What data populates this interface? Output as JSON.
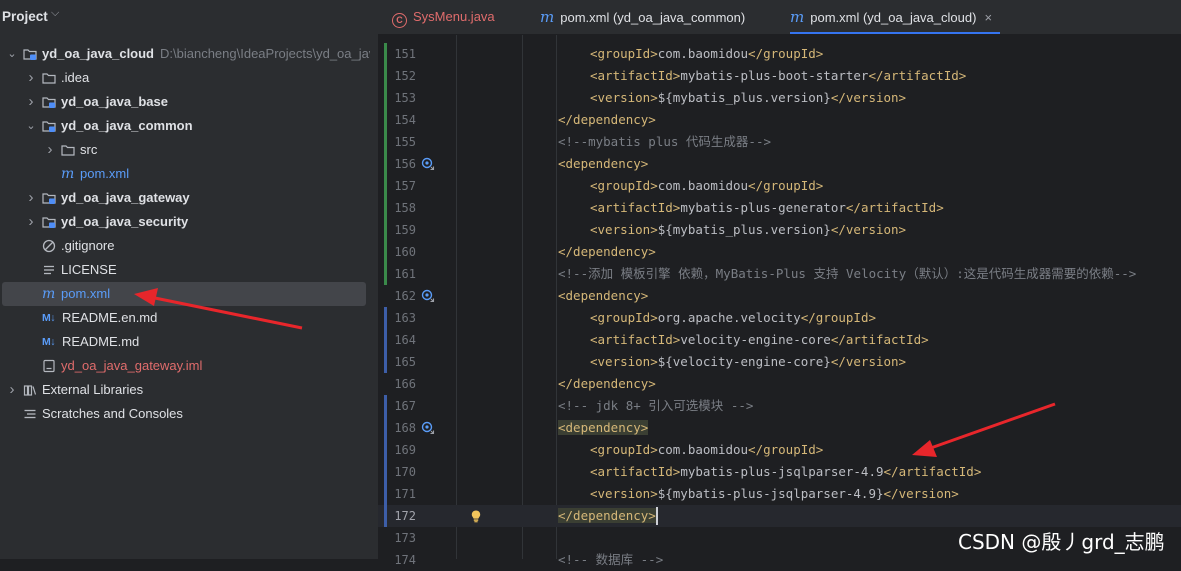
{
  "panel": {
    "title": "Project",
    "tree": [
      {
        "label": "yd_oa_java_cloud",
        "path": "D:\\biancheng\\IdeaProjects\\yd_oa_java_cloud",
        "icon": "module-folder-icon",
        "expanded": true
      },
      {
        "label": ".idea",
        "icon": "folder-icon"
      },
      {
        "label": "yd_oa_java_base",
        "icon": "module-folder-icon"
      },
      {
        "label": "yd_oa_java_common",
        "icon": "module-folder-icon",
        "expanded": true
      },
      {
        "label": "src",
        "icon": "folder-icon"
      },
      {
        "label": "pom.xml",
        "icon": "maven-icon"
      },
      {
        "label": "yd_oa_java_gateway",
        "icon": "module-folder-icon"
      },
      {
        "label": "yd_oa_java_security",
        "icon": "module-folder-icon"
      },
      {
        "label": ".gitignore",
        "icon": "ignore-icon"
      },
      {
        "label": "LICENSE",
        "icon": "text-file-icon"
      },
      {
        "label": "pom.xml",
        "icon": "maven-icon",
        "selected": true
      },
      {
        "label": "README.en.md",
        "icon": "markdown-icon",
        "icon_text": "M↓"
      },
      {
        "label": "README.md",
        "icon": "markdown-icon",
        "icon_text": "M↓"
      },
      {
        "label": "yd_oa_java_gateway.iml",
        "icon": "iml-file-icon"
      },
      {
        "label": "External Libraries",
        "icon": "libraries-icon"
      },
      {
        "label": "Scratches and Consoles",
        "icon": "scratches-icon"
      }
    ]
  },
  "tabs": [
    {
      "label": "SysMenu.java",
      "icon": "java-class-icon",
      "icon_text": "C"
    },
    {
      "label": "pom.xml (yd_oa_java_common)",
      "icon": "maven-icon"
    },
    {
      "label": "pom.xml (yd_oa_java_cloud)",
      "icon": "maven-icon",
      "active": true,
      "close": "×"
    }
  ],
  "maven_glyph": "m",
  "editor": {
    "lines": [
      {
        "n": "151",
        "code": "<groupId>com.baomidou</groupId>"
      },
      {
        "n": "152",
        "code": "<artifactId>mybatis-plus-boot-starter</artifactId>"
      },
      {
        "n": "153",
        "code": "<version>${mybatis_plus.version}</version>"
      },
      {
        "n": "154",
        "code": "</dependency>"
      },
      {
        "n": "155",
        "code": "<!--mybatis plus 代码生成器-->"
      },
      {
        "n": "156",
        "code": "<dependency>"
      },
      {
        "n": "157",
        "code": "<groupId>com.baomidou</groupId>"
      },
      {
        "n": "158",
        "code": "<artifactId>mybatis-plus-generator</artifactId>"
      },
      {
        "n": "159",
        "code": "<version>${mybatis_plus.version}</version>"
      },
      {
        "n": "160",
        "code": "</dependency>"
      },
      {
        "n": "161",
        "code": "<!--添加 模板引擎 依赖，MyBatis-Plus 支持 Velocity（默认）:这是代码生成器需要的依赖-->"
      },
      {
        "n": "162",
        "code": "<dependency>"
      },
      {
        "n": "163",
        "code": "<groupId>org.apache.velocity</groupId>"
      },
      {
        "n": "164",
        "code": "<artifactId>velocity-engine-core</artifactId>"
      },
      {
        "n": "165",
        "code": "<version>${velocity-engine-core}</version>"
      },
      {
        "n": "166",
        "code": "</dependency>"
      },
      {
        "n": "167",
        "code": "<!-- jdk 8+ 引入可选模块 -->"
      },
      {
        "n": "168",
        "code": "<dependency>"
      },
      {
        "n": "169",
        "code": "<groupId>com.baomidou</groupId>"
      },
      {
        "n": "170",
        "code": "<artifactId>mybatis-plus-jsqlparser-4.9</artifactId>"
      },
      {
        "n": "171",
        "code": "<version>${mybatis-plus-jsqlparser-4.9}</version>"
      },
      {
        "n": "172",
        "code": "</dependency>"
      },
      {
        "n": "173",
        "code": ""
      },
      {
        "n": "174",
        "code": "<!-- 数据库 -->"
      }
    ]
  },
  "watermark": "CSDN @殷丿grd_志鹏",
  "colors": {
    "accent": "#3574f0",
    "tag": "#d5b778",
    "comment": "#7a7e85",
    "annotation_arrow": "#e8262b",
    "vcs_added": "#3a8a4a",
    "vcs_modified": "#3d5ea8"
  }
}
